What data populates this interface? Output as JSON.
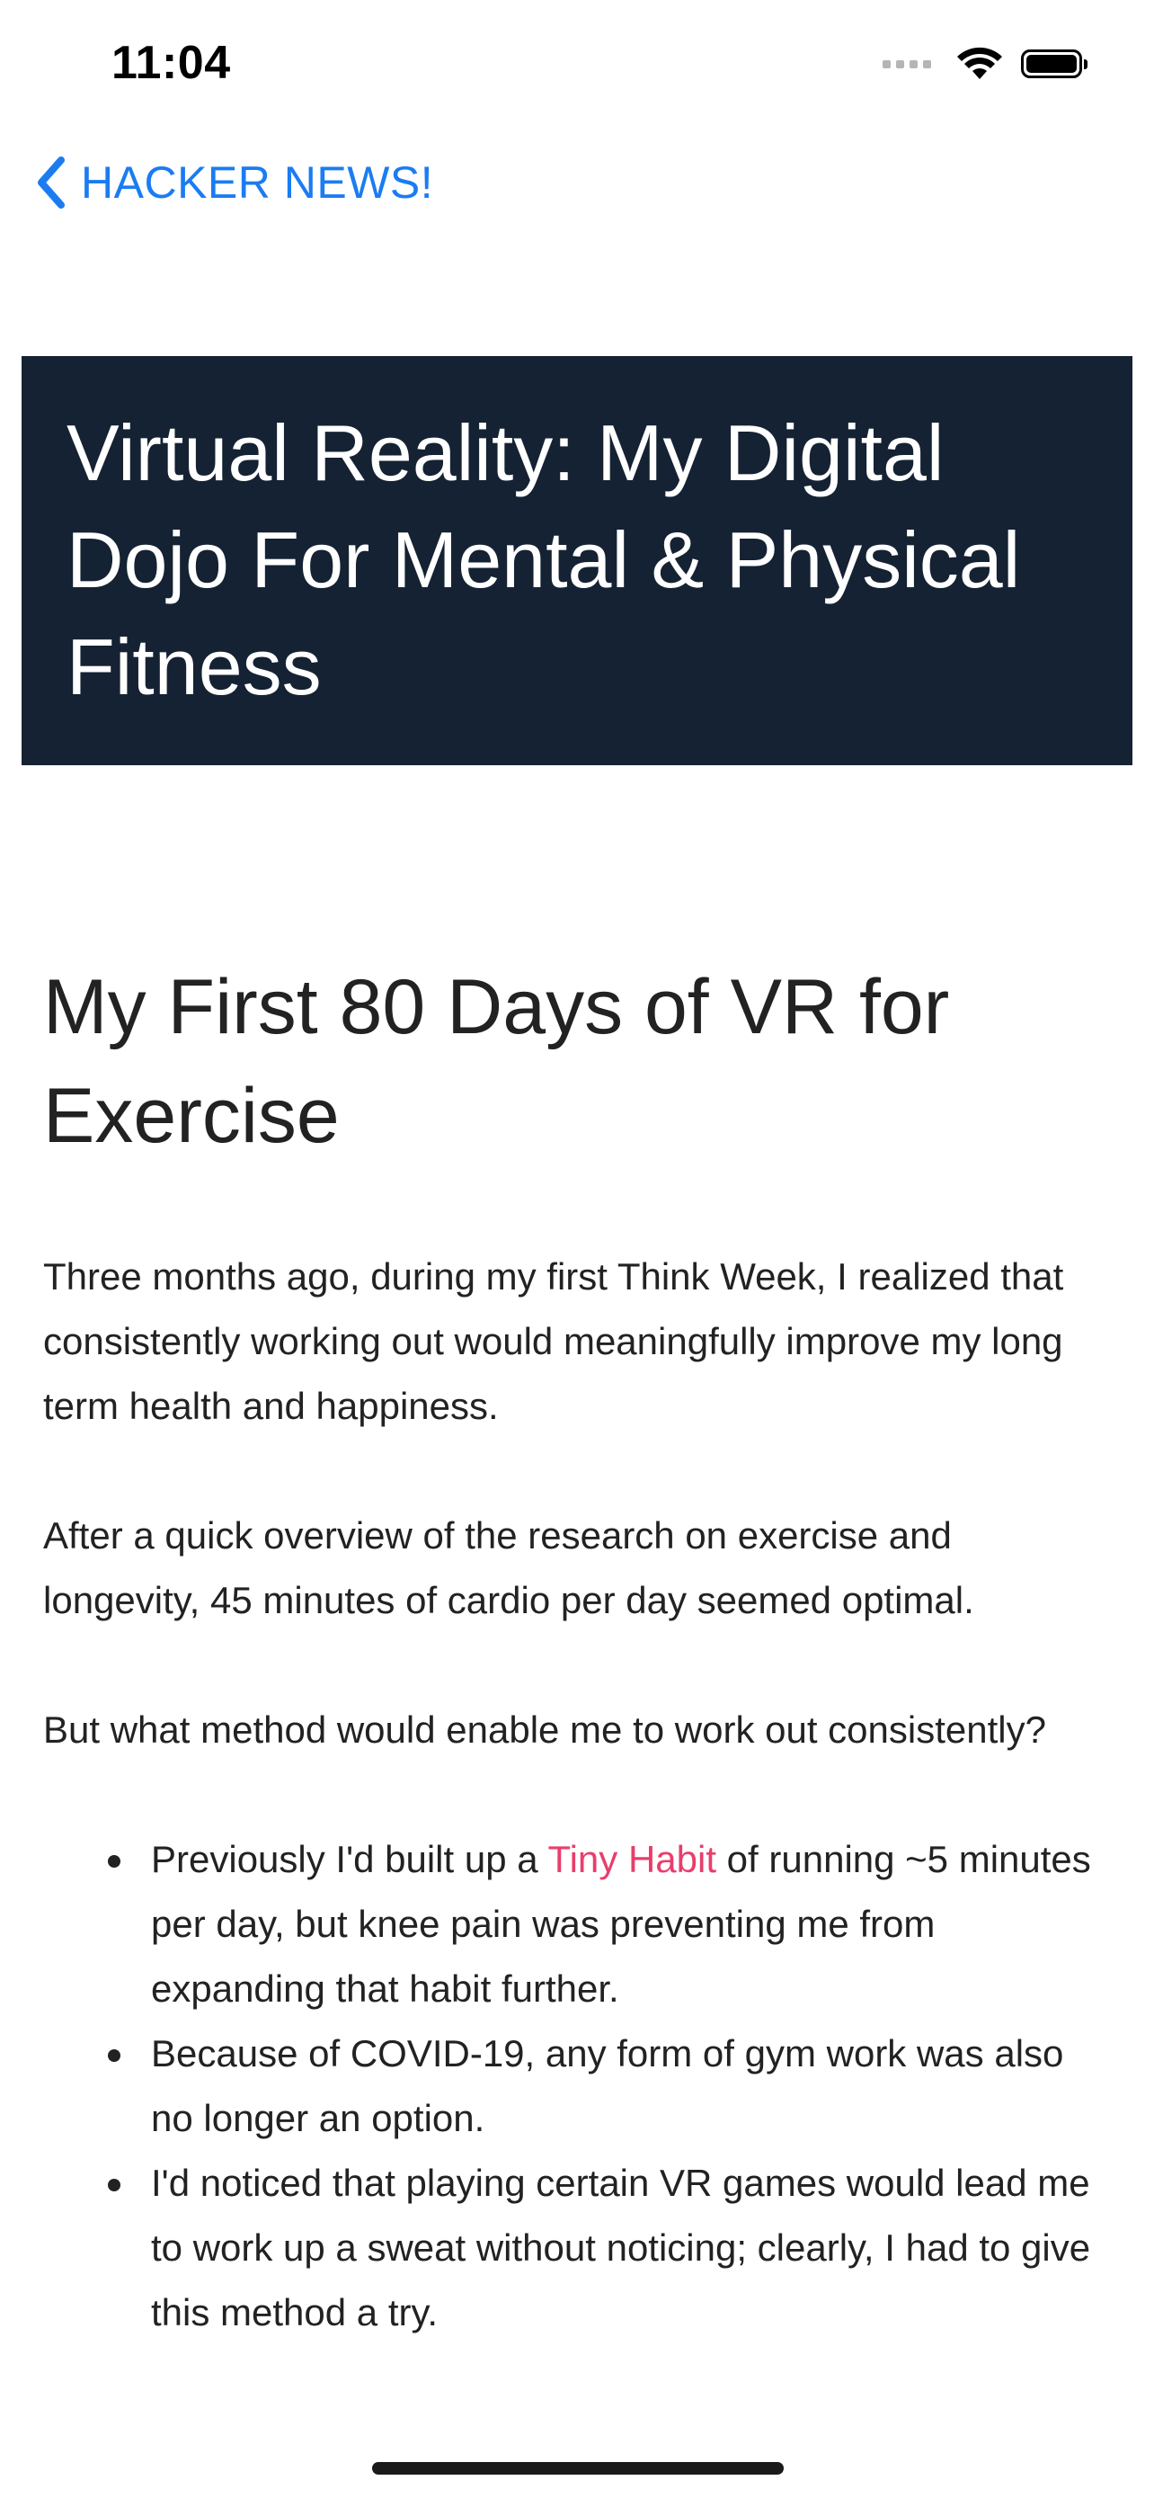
{
  "status_bar": {
    "time": "11:04"
  },
  "nav": {
    "back_label": "HACKER NEWS!"
  },
  "banner": {
    "title": "Virtual Reality: My Digital Dojo For Mental & Physical Fitness"
  },
  "article": {
    "heading": "My First 80 Days of VR for Exercise",
    "paragraphs": [
      "Three months ago, during my first Think Week, I realized that consistently working out would meaningfully improve my long term health and happiness.",
      "After a quick overview of the research on exercise and longevity, 45 minutes of cardio per day seemed optimal.",
      "But what method would enable me to work out consistently?"
    ],
    "bullets": {
      "item1_before": "Previously I'd built up a ",
      "item1_link": "Tiny Habit",
      "item1_after": " of running ~5 minutes per day, but knee pain was preventing me from expanding that habit further.",
      "item2": "Because of COVID-19, any form of gym work was also no longer an option.",
      "item3": "I'd noticed that playing certain VR games would lead me to work up a sweat without noticing; clearly, I had to give this method a try."
    }
  },
  "colors": {
    "accent": "#1b7cf2",
    "banner_bg": "#142233",
    "link": "#e83e6c"
  },
  "icons": {
    "back": "chevron-left-icon",
    "wifi": "wifi-icon",
    "battery": "battery-icon",
    "signal": "cellular-signal-icon"
  }
}
